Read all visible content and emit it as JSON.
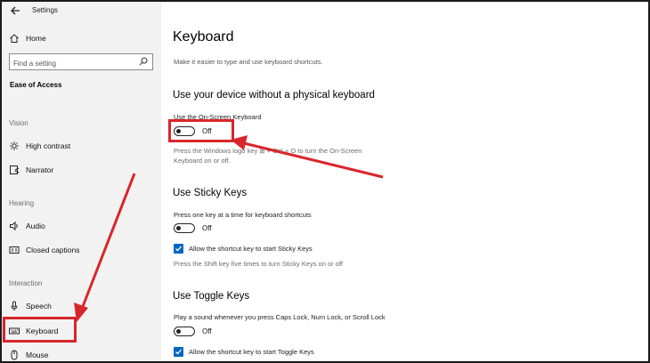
{
  "window": {
    "title": "Settings"
  },
  "sidebar": {
    "home_label": "Home",
    "search_placeholder": "Find a setting",
    "section_title": "Ease of Access",
    "groups": {
      "vision": "Vision",
      "hearing": "Hearing",
      "interaction": "Interaction"
    },
    "items": {
      "high_contrast": "High contrast",
      "narrator": "Narrator",
      "audio": "Audio",
      "closed_captions": "Closed captions",
      "speech": "Speech",
      "keyboard": "Keyboard",
      "mouse": "Mouse"
    },
    "selected_item": "Keyboard"
  },
  "main": {
    "title": "Keyboard",
    "description": "Make it easier to type and use keyboard shortcuts.",
    "onscreen": {
      "heading": "Use your device without a physical keyboard",
      "label": "Use the On-Screen Keyboard",
      "state": "Off",
      "help_line1": "Press the Windows logo key ⊞ + Ctrl + O to turn the On-Screen",
      "help_line2": "Keyboard on or off."
    },
    "sticky": {
      "heading": "Use Sticky Keys",
      "label": "Press one key at a time for keyboard shortcuts",
      "state": "Off",
      "checkbox_label": "Allow the shortcut key to start Sticky Keys",
      "checkbox_checked": true,
      "help": "Press the Shift key five times to turn Sticky Keys on or off"
    },
    "toggle_keys": {
      "heading": "Use Toggle Keys",
      "label": "Play a sound whenever you press Caps Lock, Num Lock, or Scroll Lock",
      "state": "Off",
      "checkbox_label": "Allow the shortcut key to start Toggle Keys",
      "checkbox_checked": true
    }
  },
  "colors": {
    "annotation_red": "#d9262b",
    "checkbox_blue": "#0067c0",
    "sidebar_bg": "#f2f2f2"
  }
}
